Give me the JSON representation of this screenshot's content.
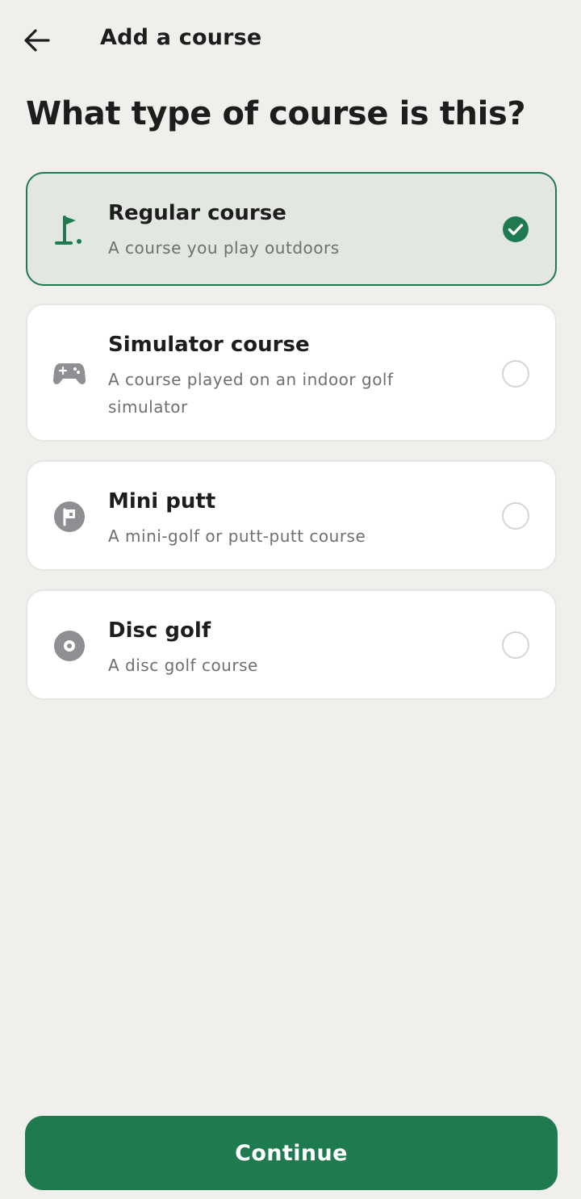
{
  "header": {
    "back_icon": "arrow-left-icon",
    "title": "Add a course"
  },
  "question": "What type of course is this?",
  "options": [
    {
      "title": "Regular course",
      "description": "A course you play outdoors",
      "icon": "golf-flag-icon",
      "selected": true
    },
    {
      "title": "Simulator course",
      "description": "A course played on an indoor golf simulator",
      "icon": "gamepad-icon",
      "selected": false
    },
    {
      "title": "Mini putt",
      "description": "A mini-golf or putt-putt course",
      "icon": "flag-circle-icon",
      "selected": false
    },
    {
      "title": "Disc golf",
      "description": "A disc golf course",
      "icon": "disc-icon",
      "selected": false
    }
  ],
  "continue_label": "Continue",
  "colors": {
    "accent": "#1f7a4f",
    "background": "#f0efec",
    "selected_card": "#e2e7e1",
    "icon_gray": "#8e8e93"
  }
}
